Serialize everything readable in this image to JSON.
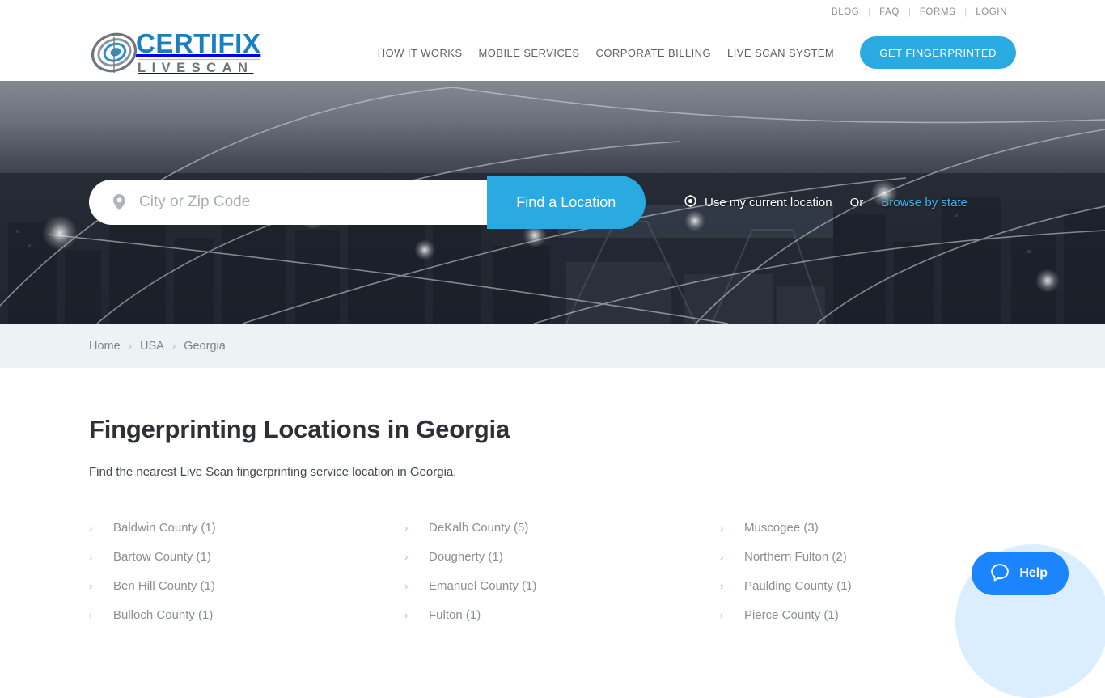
{
  "topbar": {
    "links": [
      "BLOG",
      "FAQ",
      "FORMS",
      "LOGIN"
    ],
    "separator": "|"
  },
  "header": {
    "logo": {
      "primary": "CERTIFIX",
      "secondary": "LIVESCAN",
      "mark_icon": "fingerprint-swirl-icon"
    },
    "nav": [
      "HOW IT WORKS",
      "MOBILE SERVICES",
      "CORPORATE BILLING",
      "LIVE SCAN SYSTEM"
    ],
    "cta_label": "GET FINGERPRINTED",
    "cta_color": "#29abe2"
  },
  "hero": {
    "search_placeholder": "City or Zip Code",
    "search_value": "",
    "pin_icon": "map-pin-icon",
    "find_button_label": "Find a Location",
    "locate_icon": "crosshair-target-icon",
    "locate_label": "Use my current location",
    "or_label": "Or",
    "browse_label": "Browse by state",
    "browse_color": "#3fb3ea"
  },
  "breadcrumb": {
    "items": [
      "Home",
      "USA",
      "Georgia"
    ],
    "separator": "›"
  },
  "main": {
    "title": "Fingerprinting Locations in Georgia",
    "description": "Find the nearest Live Scan fingerprinting service location in Georgia.",
    "chevron_icon": "chevron-right-icon",
    "columns": [
      [
        "Baldwin County (1)",
        "Bartow County (1)",
        "Ben Hill County (1)",
        "Bulloch County (1)"
      ],
      [
        "DeKalb County (5)",
        "Dougherty (1)",
        "Emanuel County (1)",
        "Fulton (1)"
      ],
      [
        "Muscogee (3)",
        "Northern Fulton (2)",
        "Paulding County (1)",
        "Pierce County (1)"
      ]
    ]
  },
  "help_widget": {
    "label": "Help",
    "icon": "chat-bubble-icon",
    "button_color": "#1b84ff",
    "halo_color": "#dbeeff"
  }
}
